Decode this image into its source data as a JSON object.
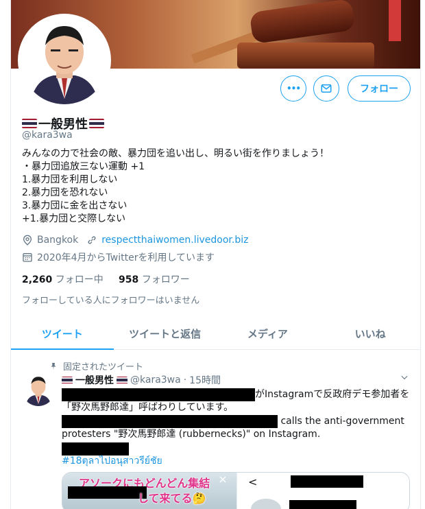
{
  "profile": {
    "display_name": "一般男性",
    "handle": "@kara3wa",
    "bio_lines": [
      "みんなの力で社会の敵、暴力団を追い出し、明るい街を作りましょう！",
      "・暴力団追放三ない運動 +1",
      "1.暴力団を利用しない",
      "2.暴力団を恐れない",
      "3.暴力団に金を出さない",
      "+1.暴力団と交際しない"
    ],
    "location": "Bangkok",
    "website": "respectthaiwomen.livedoor.biz",
    "joined": "2020年4月からTwitterを利用しています",
    "following_count": "2,260",
    "following_label": "フォロー中",
    "followers_count": "958",
    "followers_label": "フォロワー",
    "followers_note": "フォローしている人にフォロワーはいません"
  },
  "actions": {
    "more_icon": "•••",
    "follow_label": "フォロー"
  },
  "tabs": [
    {
      "label": "ツイート",
      "active": true
    },
    {
      "label": "ツイートと返信",
      "active": false
    },
    {
      "label": "メディア",
      "active": false
    },
    {
      "label": "いいね",
      "active": false
    }
  ],
  "tweet": {
    "pinned_label": "固定されたツイート",
    "name": "一般男性",
    "handle": "@kara3wa",
    "separator": "·",
    "time": "15時間",
    "line1_tail": "がInstagramで反政府デモ参加者を",
    "line2": "「野次馬野郎達」呼ばわりしています。",
    "line3_tail": "calls the anti-government",
    "line4": "protesters \"野次馬野郎達 (rubbernecks)\" on Instagram.",
    "hashtag": "#18ตุลาไปอนุสาวรีย์ชัย",
    "media_caption_1": "アソークにもどんどん集結",
    "media_caption_2": "して来てる🤔",
    "media_back": "<"
  },
  "colors": {
    "accent": "#1da1f2",
    "text_gray": "#657786",
    "link": "#1b95e0",
    "thai_red": "#a51931",
    "thai_white": "#f4f5f8",
    "thai_blue": "#2d2a4a"
  },
  "icons": {
    "more": "more-icon",
    "message": "message-icon",
    "location": "location-pin-icon",
    "link": "link-icon",
    "calendar": "calendar-icon",
    "pin": "pin-icon",
    "chevron": "chevron-down-icon",
    "close": "close-icon"
  }
}
